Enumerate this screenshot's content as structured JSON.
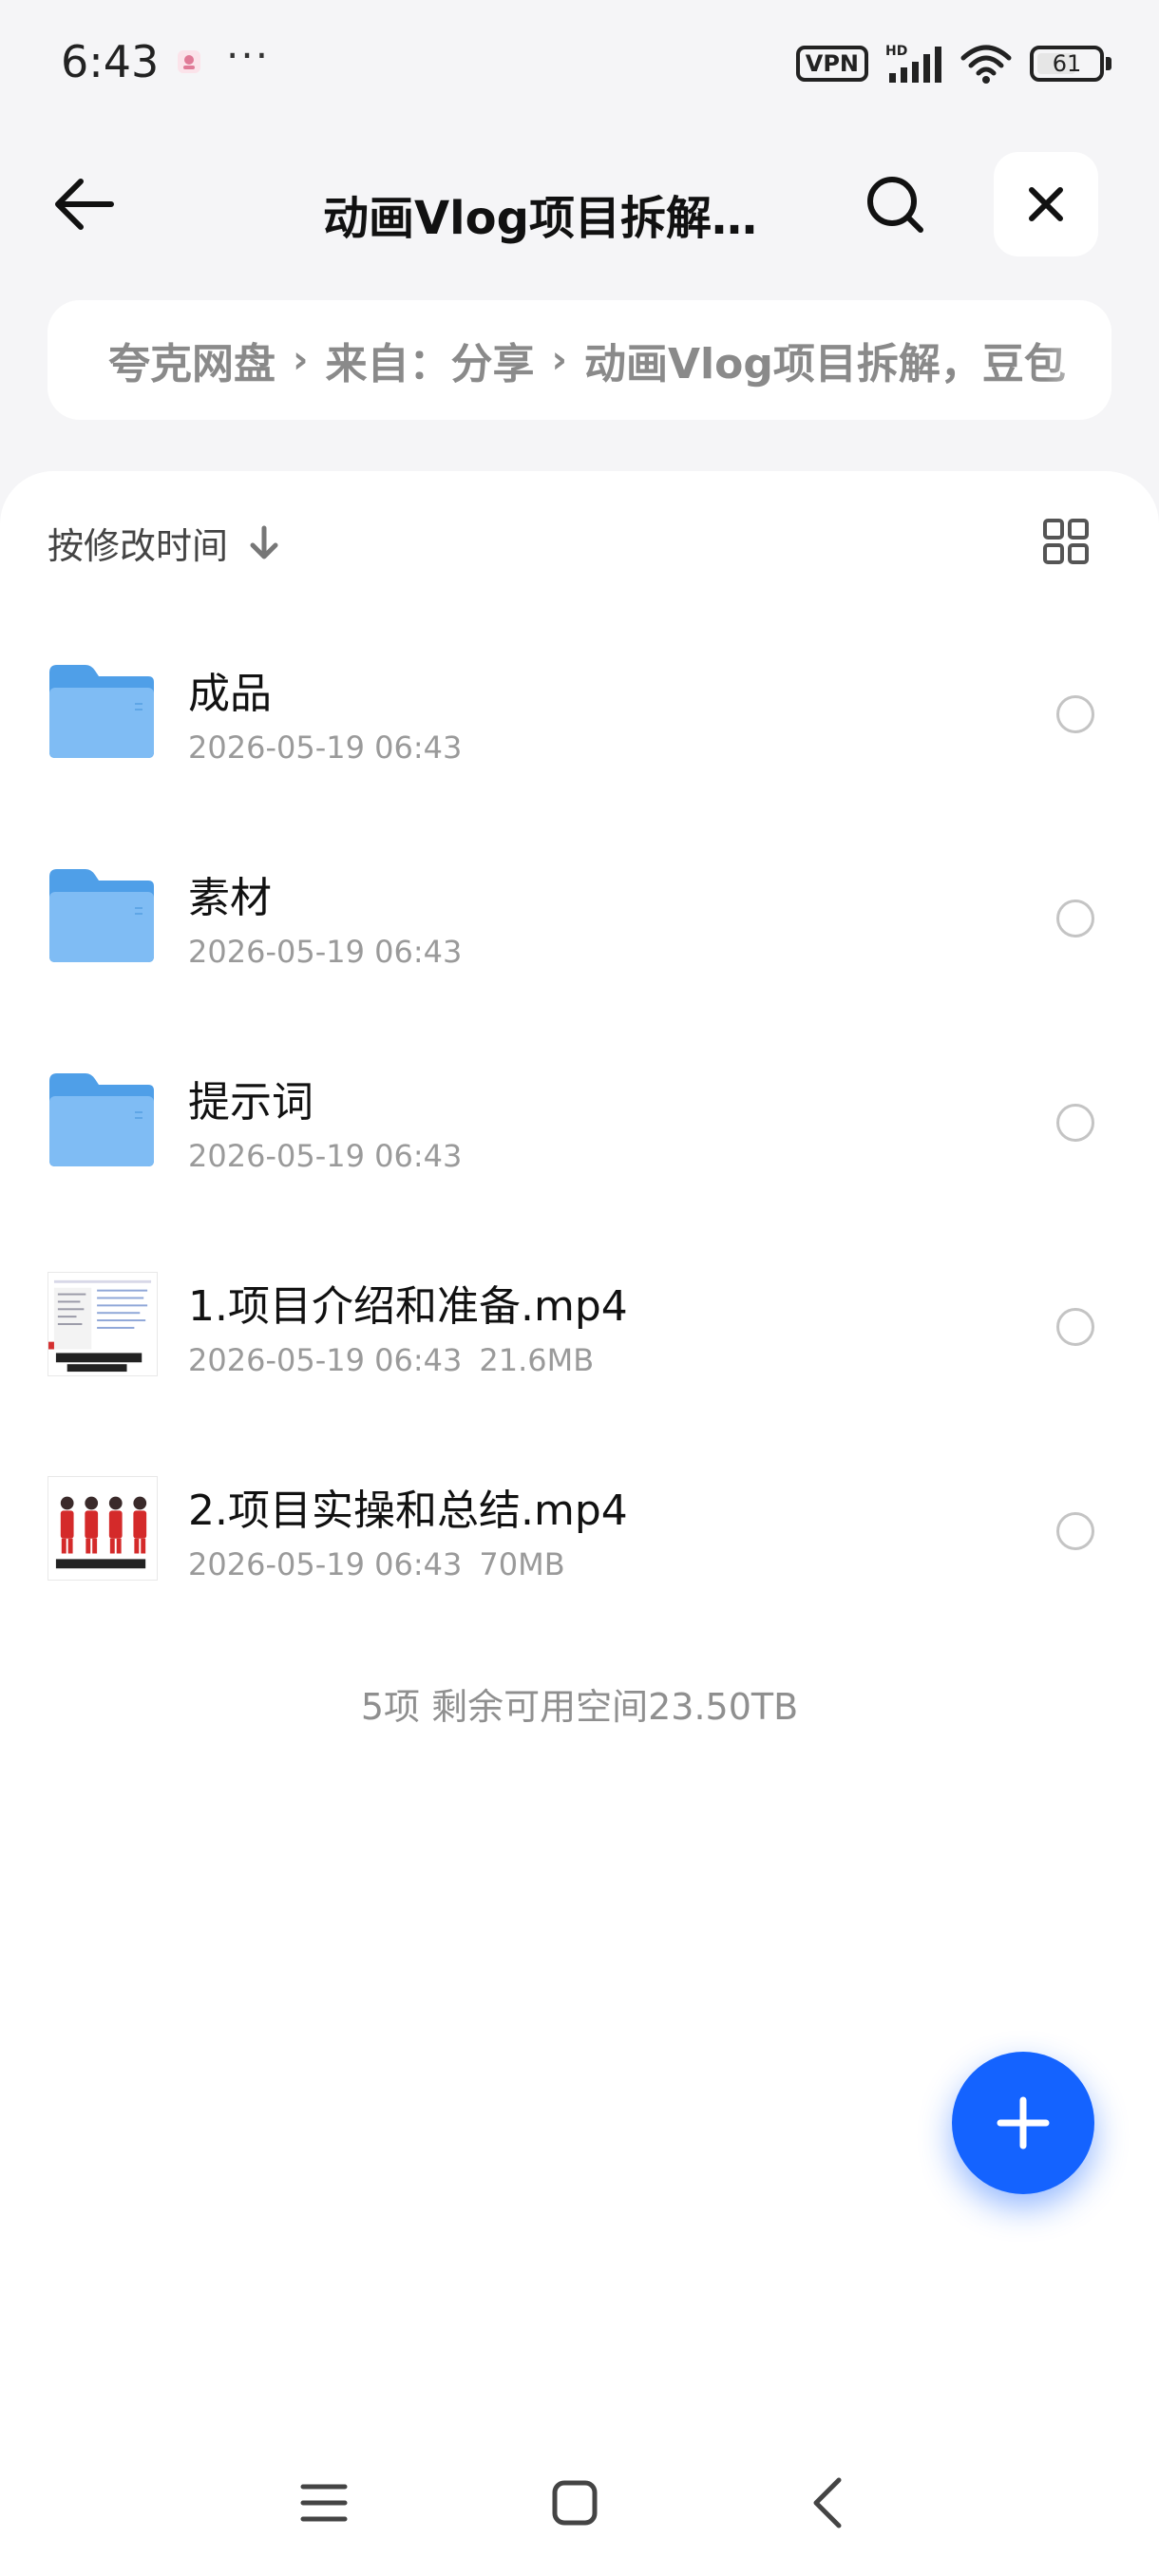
{
  "status_bar": {
    "time": "6:43",
    "dots": "···",
    "vpn": "VPN",
    "network": "HD",
    "battery": "61"
  },
  "header": {
    "title": "动画Vlog项目拆解…"
  },
  "breadcrumb": {
    "items": [
      "夸克网盘",
      "来自：分享",
      "动画Vlog项目拆解，豆包"
    ]
  },
  "toolbar": {
    "sort_label": "按修改时间"
  },
  "files": [
    {
      "name": "成品",
      "date": "2026-05-19 06:43",
      "size": "",
      "type": "folder"
    },
    {
      "name": "素材",
      "date": "2026-05-19 06:43",
      "size": "",
      "type": "folder"
    },
    {
      "name": "提示词",
      "date": "2026-05-19 06:43",
      "size": "",
      "type": "folder"
    },
    {
      "name": "1.项目介绍和准备.mp4",
      "date": "2026-05-19 06:43",
      "size": "21.6MB",
      "type": "video"
    },
    {
      "name": "2.项目实操和总结.mp4",
      "date": "2026-05-19 06:43",
      "size": "70MB",
      "type": "video"
    }
  ],
  "summary": "5项 剩余可用空间23.50TB",
  "colors": {
    "accent": "#1463ff",
    "folder": "#5aa9f0",
    "page_bg": "#f5f5f7"
  },
  "icons": {
    "back": "arrow-left-icon",
    "search": "search-icon",
    "close": "close-icon",
    "sort": "arrow-down-icon",
    "grid": "grid-view-icon",
    "fab": "plus-icon"
  }
}
